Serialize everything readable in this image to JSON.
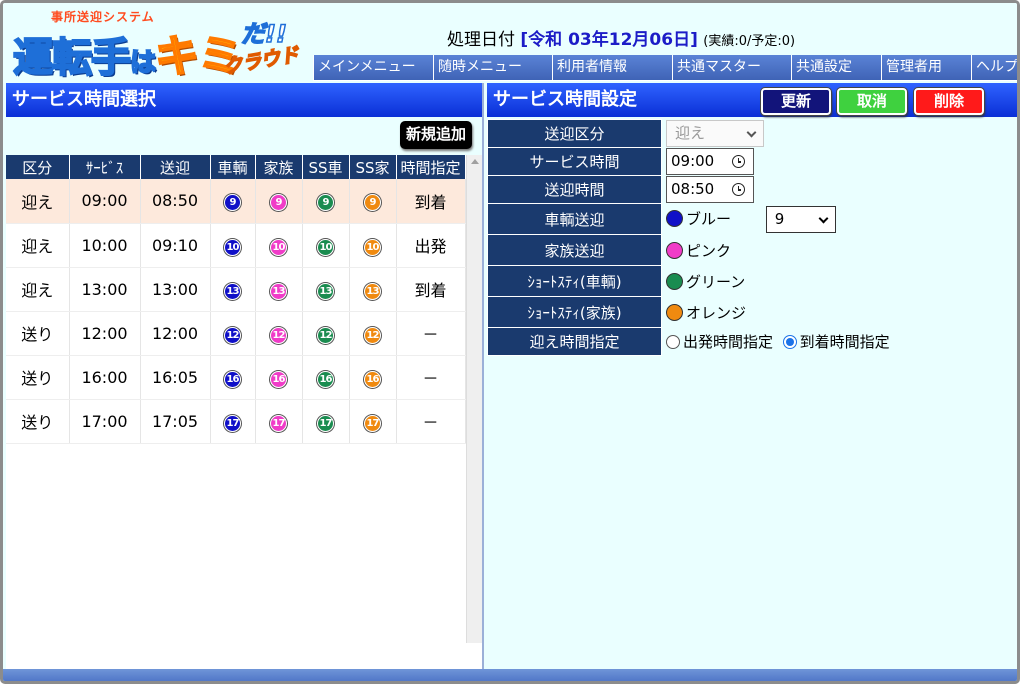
{
  "logo": {
    "subtitle": "事所送迎システム",
    "main_1": "運転手",
    "main_ha": "は",
    "main_kimi": "キミ",
    "da": "だ!!",
    "cloud": "クラウド"
  },
  "header": {
    "date_label": "処理日付",
    "date_value": "[令和 03年12月06日]",
    "status": "(実績:0/予定:0)"
  },
  "menu": [
    "メインメニュー",
    "随時メニュー",
    "利用者情報",
    "共通マスター",
    "共通設定",
    "管理者用",
    "ヘルプ"
  ],
  "left": {
    "title": "サービス時間選択",
    "new_button": "新規追加",
    "columns": [
      "区分",
      "ｻｰﾋﾞｽ",
      "送迎",
      "車輌",
      "家族",
      "SS車",
      "SS家",
      "時間指定"
    ],
    "rows": [
      {
        "kubun": "迎え",
        "service": "09:00",
        "sougei": "08:50",
        "n": "9",
        "shitei": "到着",
        "selected": true
      },
      {
        "kubun": "迎え",
        "service": "10:00",
        "sougei": "09:10",
        "n": "10",
        "shitei": "出発",
        "selected": false
      },
      {
        "kubun": "迎え",
        "service": "13:00",
        "sougei": "13:00",
        "n": "13",
        "shitei": "到着",
        "selected": false
      },
      {
        "kubun": "送り",
        "service": "12:00",
        "sougei": "12:00",
        "n": "12",
        "shitei": "－",
        "selected": false
      },
      {
        "kubun": "送り",
        "service": "16:00",
        "sougei": "16:05",
        "n": "16",
        "shitei": "－",
        "selected": false
      },
      {
        "kubun": "送り",
        "service": "17:00",
        "sougei": "17:05",
        "n": "17",
        "shitei": "－",
        "selected": false
      }
    ]
  },
  "right": {
    "title": "サービス時間設定",
    "update_button": "更新",
    "cancel_button": "取消",
    "delete_button": "削除",
    "form": {
      "kubun_label": "送迎区分",
      "kubun_value": "迎え",
      "service_time_label": "サービス時間",
      "service_time_value": "09:00",
      "sougei_time_label": "送迎時間",
      "sougei_time_value": "08:50",
      "vehicle_label": "車輌送迎",
      "vehicle_color_name": "ブルー",
      "vehicle_number": "9",
      "family_label": "家族送迎",
      "family_color_name": "ピンク",
      "short_vehicle_label": "ｼｮｰﾄｽﾃｨ(車輌)",
      "short_vehicle_color_name": "グリーン",
      "short_family_label": "ｼｮｰﾄｽﾃｨ(家族)",
      "short_family_color_name": "オレンジ",
      "pickup_time_label": "迎え時間指定",
      "radio_departure": "出発時間指定",
      "radio_arrival": "到着時間指定",
      "selected_radio": "arrival"
    }
  },
  "colors": {
    "blue": "#1010c8",
    "pink": "#f03cc8",
    "green": "#1a8c50",
    "orange": "#f08a10"
  }
}
